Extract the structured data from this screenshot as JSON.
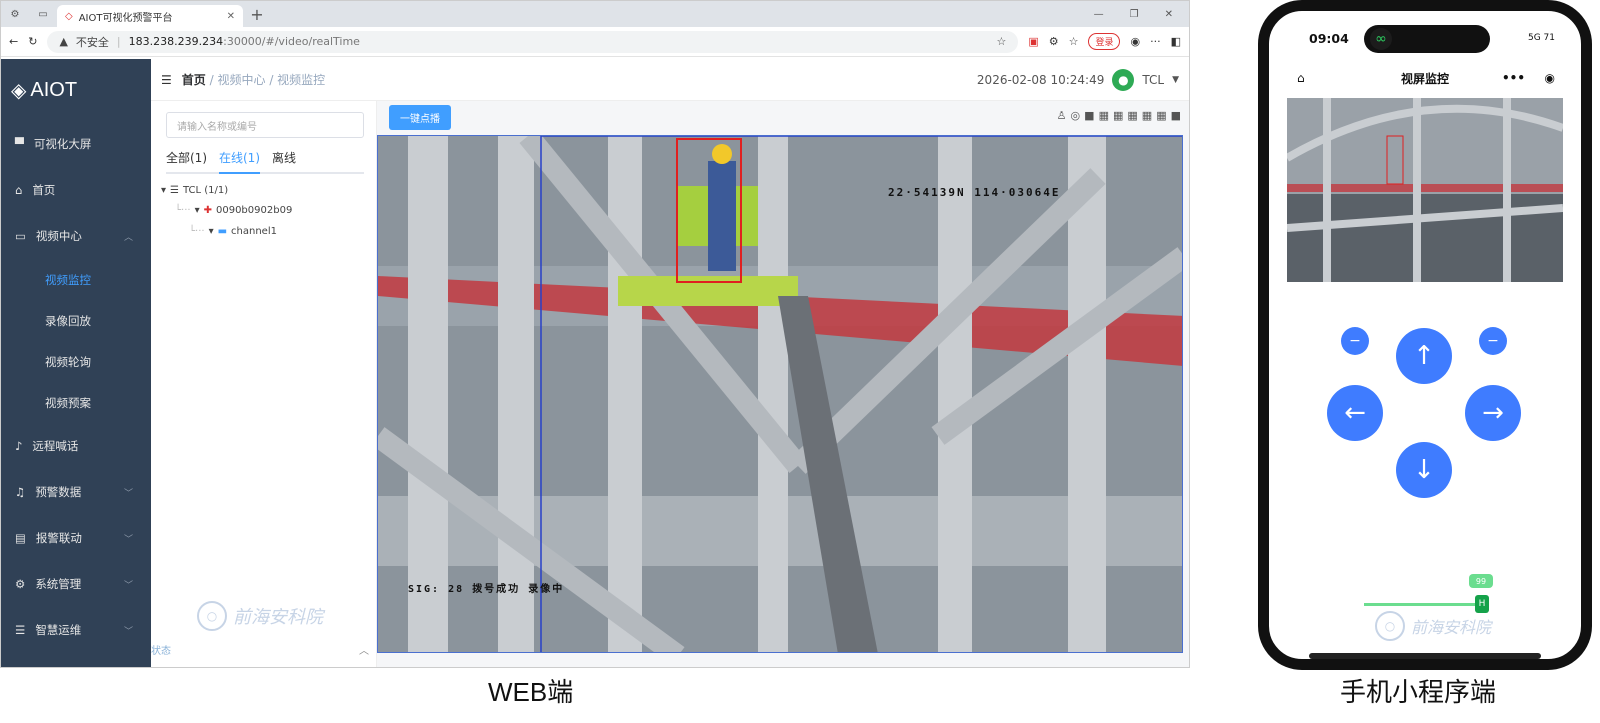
{
  "browser": {
    "tab_title": "AIOT可视化预警平台",
    "tab_close": "✕",
    "new_tab": "+",
    "security": "不安全",
    "url_host": "183.238.239.234",
    "url_path": ":30000/#/video/realTime",
    "login_label": "登录"
  },
  "app": {
    "brand": "AIOT",
    "menu": [
      {
        "label": "可视化大屏"
      },
      {
        "label": "首页"
      },
      {
        "label": "视频中心"
      },
      {
        "label": "远程喊话"
      },
      {
        "label": "预警数据"
      },
      {
        "label": "报警联动"
      },
      {
        "label": "系统管理"
      },
      {
        "label": "智慧运维"
      }
    ],
    "submenu": [
      "视频监控",
      "录像回放",
      "视频轮询",
      "视频预案"
    ]
  },
  "topbar": {
    "breadcrumb": [
      "首页",
      "视频中心",
      "视频监控"
    ],
    "datetime": "2026-02-08 10:24:49",
    "user": "TCL"
  },
  "tree": {
    "search_placeholder": "请输入名称或编号",
    "tabs": [
      "全部(1)",
      "在线(1)",
      "离线"
    ],
    "root": "TCL (1/1)",
    "device": "0090b0902b09",
    "channel": "channel1",
    "status_label": "状态"
  },
  "player": {
    "one_click_play": "一键点播",
    "coords": "22·54139N 114·03064E",
    "sig": "SIG: 28",
    "sig_status": "拨号成功  录像中"
  },
  "watermark": "前海安科院",
  "phone": {
    "time": "09:04",
    "status": "5G 71",
    "title": "视屏监控",
    "more": "•••",
    "slider_value": "99",
    "slider_thumb": "H",
    "arrows": {
      "up": "↑",
      "down": "↓",
      "left": "←",
      "right": "→",
      "minus": "−"
    }
  },
  "captions": {
    "web": "WEB端",
    "mobile": "手机小程序端"
  },
  "colors": {
    "sidebar": "#304156",
    "accent": "#409eff",
    "dpad": "#3f7cff"
  }
}
